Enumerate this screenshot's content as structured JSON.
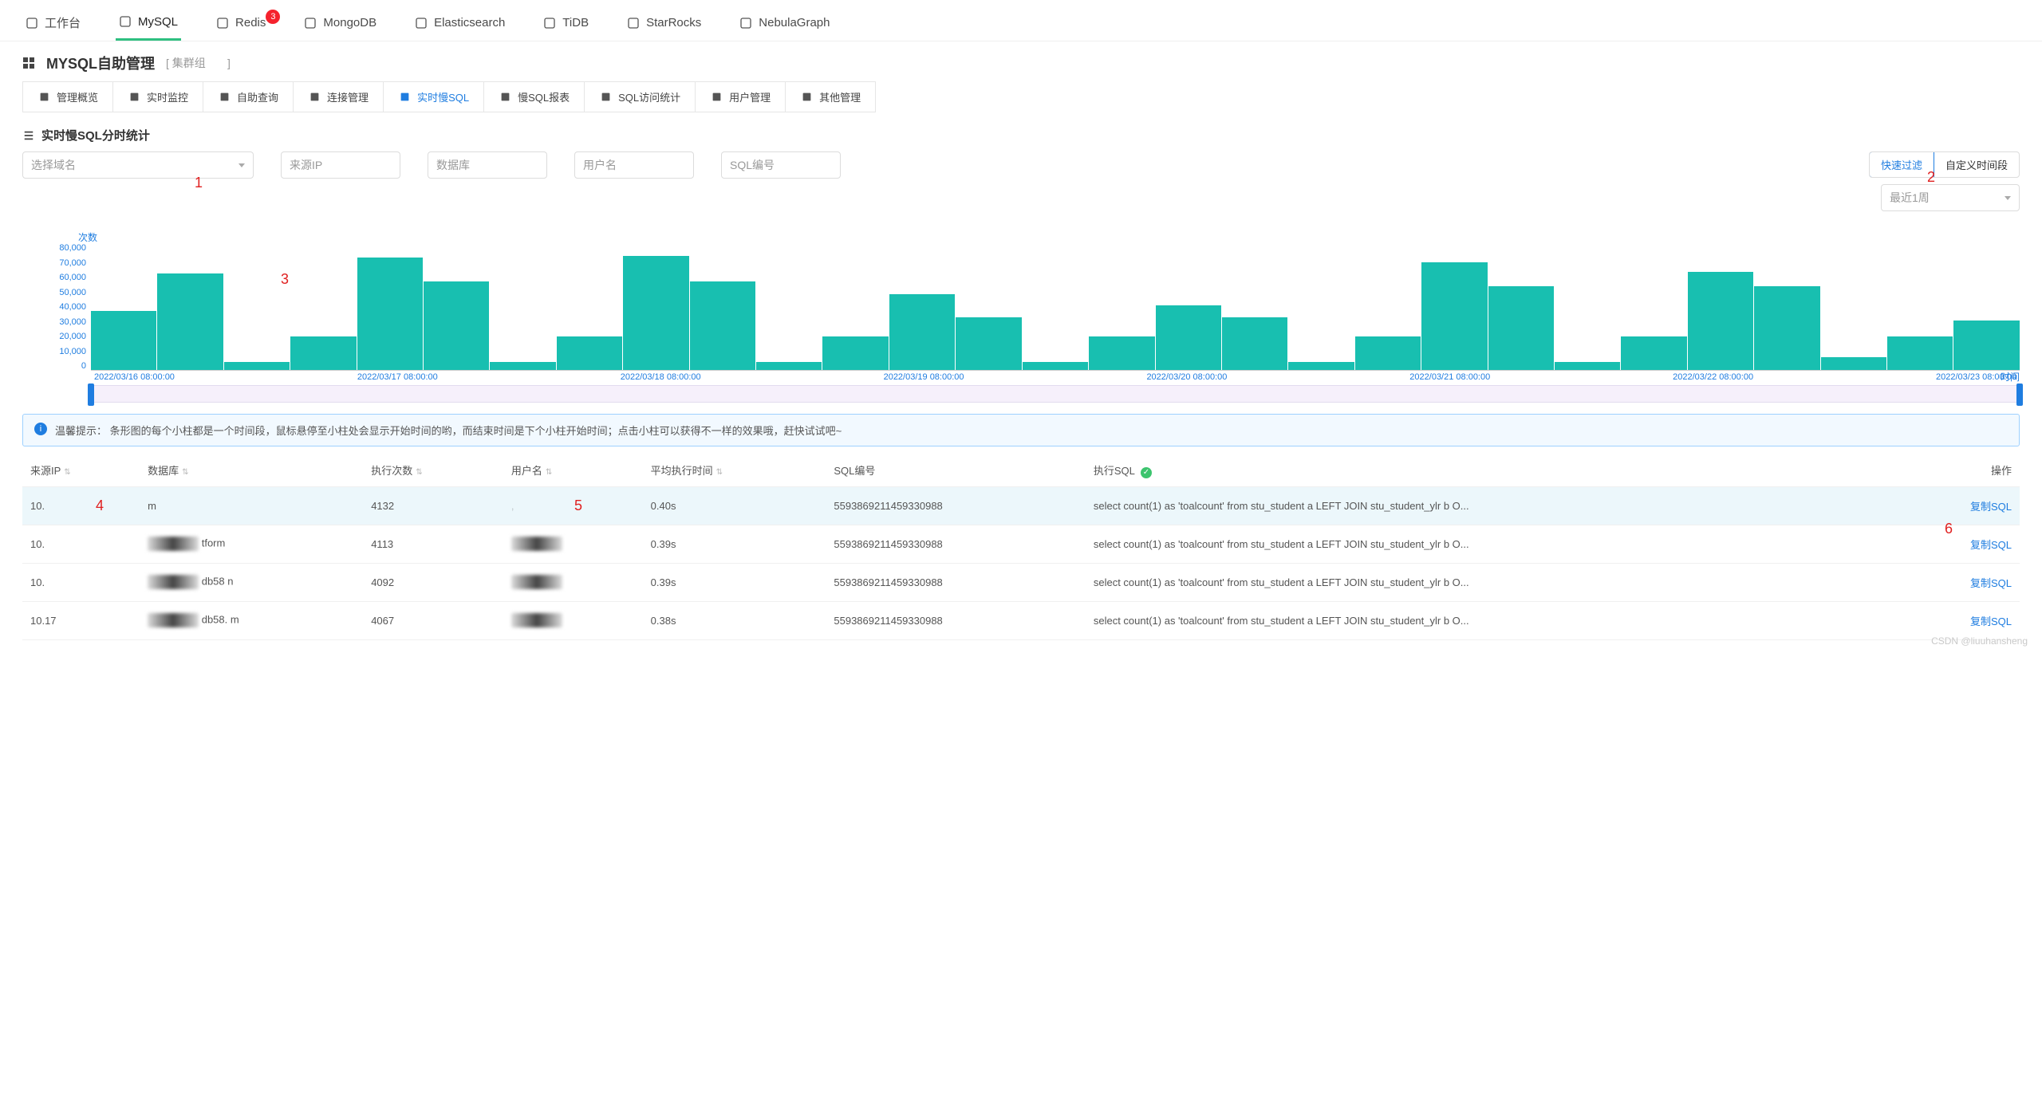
{
  "top_tabs": [
    {
      "label": "工作台",
      "icon": "home-icon",
      "active": false,
      "badge": null
    },
    {
      "label": "MySQL",
      "icon": "mysql-icon",
      "active": true,
      "badge": null
    },
    {
      "label": "Redis",
      "icon": "redis-icon",
      "active": false,
      "badge": "3"
    },
    {
      "label": "MongoDB",
      "icon": "mongodb-icon",
      "active": false,
      "badge": null
    },
    {
      "label": "Elasticsearch",
      "icon": "elasticsearch-icon",
      "active": false,
      "badge": null
    },
    {
      "label": "TiDB",
      "icon": "tidb-icon",
      "active": false,
      "badge": null
    },
    {
      "label": "StarRocks",
      "icon": "starrocks-icon",
      "active": false,
      "badge": null
    },
    {
      "label": "NebulaGraph",
      "icon": "nebulagraph-icon",
      "active": false,
      "badge": null
    }
  ],
  "header": {
    "title": "MYSQL自助管理",
    "cluster_prefix": "[ 集群组",
    "cluster_suffix": "]"
  },
  "sub_tabs": [
    {
      "label": "管理概览",
      "icon": "doc-icon"
    },
    {
      "label": "实时监控",
      "icon": "chart-icon"
    },
    {
      "label": "自助查询",
      "icon": "db-icon"
    },
    {
      "label": "连接管理",
      "icon": "link-icon"
    },
    {
      "label": "实时慢SQL",
      "icon": "pulse-icon",
      "active": true
    },
    {
      "label": "慢SQL报表",
      "icon": "calendar-icon"
    },
    {
      "label": "SQL访问统计",
      "icon": "camera-icon"
    },
    {
      "label": "用户管理",
      "icon": "user-icon"
    },
    {
      "label": "其他管理",
      "icon": "gear-icon"
    }
  ],
  "section_title": "实时慢SQL分时统计",
  "filters": {
    "domain_placeholder": "选择域名",
    "source_ip_placeholder": "来源IP",
    "db_placeholder": "数据库",
    "user_placeholder": "用户名",
    "sql_no_placeholder": "SQL编号",
    "quick_filter": "快速过滤",
    "custom_range": "自定义时间段",
    "period_placeholder": "最近1周"
  },
  "annotations": {
    "n1": "1",
    "n2": "2",
    "n3": "3",
    "n4": "4",
    "n5": "5",
    "n6": "6"
  },
  "chart_data": {
    "type": "bar",
    "ylabel": "次数",
    "xlabel": "时间",
    "ylim": [
      0,
      80000
    ],
    "y_ticks": [
      "80,000",
      "70,000",
      "60,000",
      "50,000",
      "40,000",
      "30,000",
      "20,000",
      "10,000",
      "0"
    ],
    "x_ticks": [
      "2022/03/16 08:00:00",
      "2022/03/17 08:00:00",
      "2022/03/18 08:00:00",
      "2022/03/19 08:00:00",
      "2022/03/20 08:00:00",
      "2022/03/21 08:00:00",
      "2022/03/22 08:00:00",
      "2022/03/23 08:00:00"
    ],
    "values": [
      37000,
      61000,
      5000,
      21000,
      71000,
      56000,
      5000,
      21000,
      72000,
      56000,
      5000,
      21000,
      48000,
      33000,
      5000,
      21000,
      41000,
      33000,
      5000,
      21000,
      68000,
      53000,
      5000,
      21000,
      62000,
      53000,
      8000,
      21000,
      31000
    ]
  },
  "tip": {
    "label": "温馨提示：",
    "text": "条形图的每个小柱都是一个时间段，鼠标悬停至小柱处会显示开始时间的哟，而结束时间是下个小柱开始时间；点击小柱可以获得不一样的效果哦，赶快试试吧~"
  },
  "table": {
    "columns": [
      "来源IP",
      "数据库",
      "执行次数",
      "用户名",
      "平均执行时间",
      "SQL编号",
      "执行SQL",
      "操作"
    ],
    "rows": [
      {
        "ip": "10.",
        "db": "m",
        "count": "4132",
        "user": "",
        "avg": "0.40s",
        "sqlno": "5593869211459330988",
        "sql": "select count(1) as 'toalcount' from stu_student a LEFT JOIN stu_student_ylr b O...",
        "action": "复制SQL"
      },
      {
        "ip": "10.",
        "db": "tform",
        "count": "4113",
        "user": "",
        "avg": "0.39s",
        "sqlno": "5593869211459330988",
        "sql": "select count(1) as 'toalcount' from stu_student a LEFT JOIN stu_student_ylr b O...",
        "action": "复制SQL"
      },
      {
        "ip": "10.",
        "db": "db58          n",
        "count": "4092",
        "user": "",
        "avg": "0.39s",
        "sqlno": "5593869211459330988",
        "sql": "select count(1) as 'toalcount' from stu_student a LEFT JOIN stu_student_ylr b O...",
        "action": "复制SQL"
      },
      {
        "ip": "10.17",
        "db": "db58.        m",
        "count": "4067",
        "user": "",
        "avg": "0.38s",
        "sqlno": "5593869211459330988",
        "sql": "select count(1) as 'toalcount' from stu_student a LEFT JOIN stu_student_ylr b O...",
        "action": "复制SQL"
      }
    ]
  },
  "watermark": "CSDN @liuuhansheng"
}
